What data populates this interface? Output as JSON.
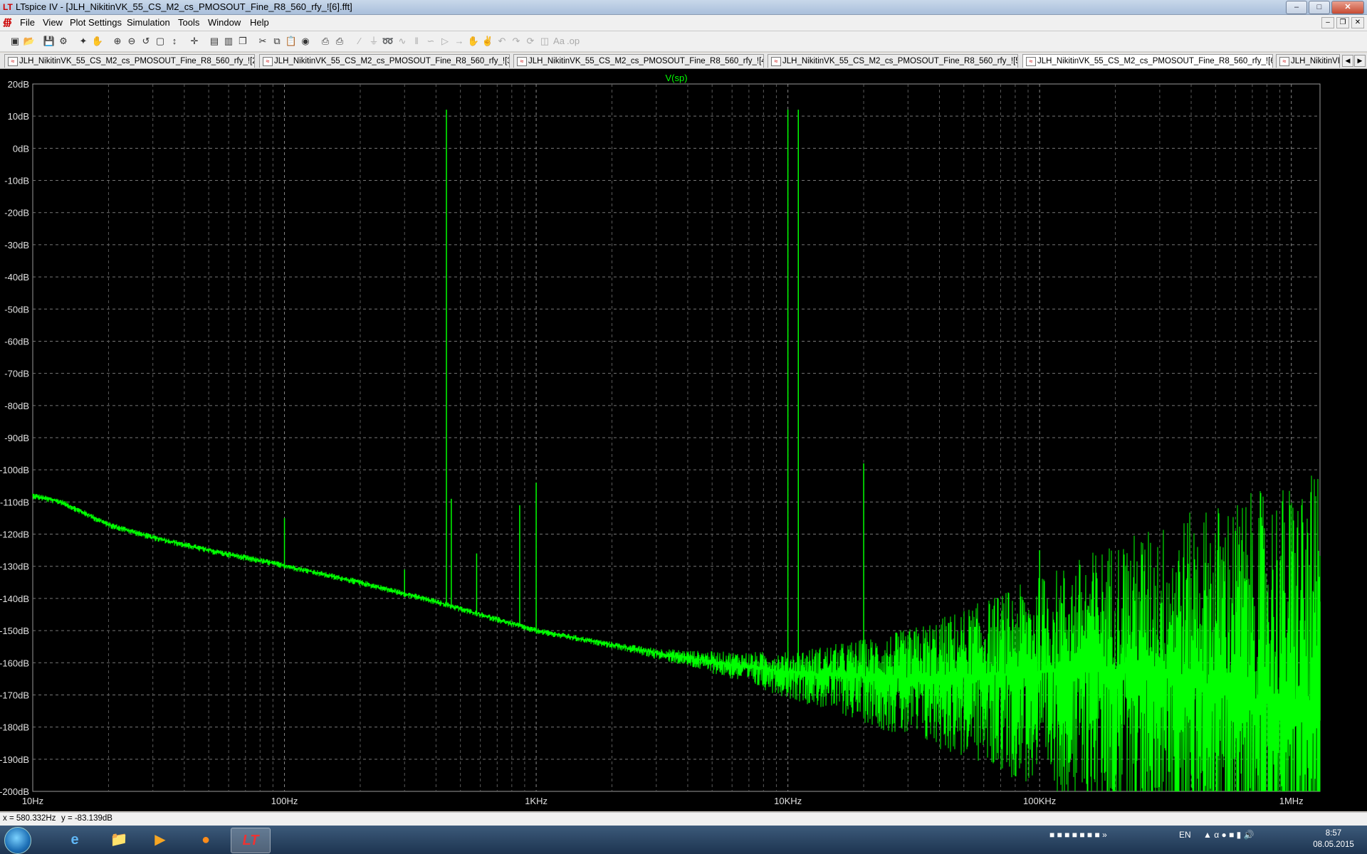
{
  "window": {
    "title": "LTspice IV - [JLH_NikitinVK_55_CS_M2_cs_PMOSOUT_Fine_R8_560_rfy_![6].fft]",
    "icon": "ltspice-icon"
  },
  "menubar": {
    "items": [
      "File",
      "View",
      "Plot Settings",
      "Simulation",
      "Tools",
      "Window",
      "Help"
    ]
  },
  "toolbar": {
    "icons": [
      "new-schematic-icon",
      "open-icon",
      "save-icon",
      "control-panel-icon",
      "run-icon",
      "halt-icon",
      "zoom-in-icon",
      "zoom-out-icon",
      "zoom-back-icon",
      "zoom-fit-icon",
      "autoscale-icon",
      "cursor-icon",
      "tile-horizontal-icon",
      "tile-vertical-icon",
      "cascade-icon",
      "cut-icon",
      "copy-icon",
      "paste-icon",
      "find-icon",
      "print-icon",
      "print-preview-icon",
      "wire-icon",
      "ground-icon",
      "label-icon",
      "resistor-icon",
      "capacitor-icon",
      "inductor-icon",
      "diode-icon",
      "component-icon",
      "move-icon",
      "drag-icon",
      "undo-icon",
      "redo-icon",
      "rotate-icon",
      "mirror-icon",
      "text-icon",
      "spice-directive-icon"
    ]
  },
  "tabs": [
    {
      "label": "JLH_NikitinVK_55_CS_M2_cs_PMOSOUT_Fine_R8_560_rfy_![2].fft",
      "active": false
    },
    {
      "label": "JLH_NikitinVK_55_CS_M2_cs_PMOSOUT_Fine_R8_560_rfy_![3].fft",
      "active": false
    },
    {
      "label": "JLH_NikitinVK_55_CS_M2_cs_PMOSOUT_Fine_R8_560_rfy_![4].fft",
      "active": false
    },
    {
      "label": "JLH_NikitinVK_55_CS_M2_cs_PMOSOUT_Fine_R8_560_rfy_![5].fft",
      "active": false
    },
    {
      "label": "JLH_NikitinVK_55_CS_M2_cs_PMOSOUT_Fine_R8_560_rfy_![6].fft",
      "active": true
    },
    {
      "label": "JLH_NikitinVK",
      "active": false
    }
  ],
  "chart_data": {
    "type": "line",
    "title": "V(sp)",
    "series": [
      {
        "name": "V(sp)",
        "color": "#00ff00"
      }
    ],
    "x_scale": "log",
    "xlim_hz": [
      10,
      1300000
    ],
    "x_ticks": [
      "10Hz",
      "100Hz",
      "1KHz",
      "10KHz",
      "100KHz",
      "1MHz"
    ],
    "ylim_db": [
      -200,
      20
    ],
    "y_ticks": [
      "20dB",
      "10dB",
      "0dB",
      "-10dB",
      "-20dB",
      "-30dB",
      "-40dB",
      "-50dB",
      "-60dB",
      "-70dB",
      "-80dB",
      "-90dB",
      "-100dB",
      "-110dB",
      "-120dB",
      "-130dB",
      "-140dB",
      "-150dB",
      "-160dB",
      "-170dB",
      "-180dB",
      "-190dB",
      "-200dB"
    ],
    "grid": true,
    "background": "#000000",
    "noise_floor": [
      [
        10,
        -108
      ],
      [
        13,
        -110
      ],
      [
        20,
        -117
      ],
      [
        30,
        -121
      ],
      [
        50,
        -125
      ],
      [
        90,
        -129
      ],
      [
        200,
        -135
      ],
      [
        400,
        -141
      ],
      [
        1000,
        -150
      ],
      [
        3000,
        -157
      ],
      [
        10000,
        -163
      ],
      [
        30000,
        -165
      ],
      [
        100000,
        -163
      ],
      [
        200000,
        -162
      ],
      [
        500000,
        -167
      ],
      [
        1300000,
        -178
      ]
    ],
    "peaks": [
      {
        "x": 100,
        "y": -115
      },
      {
        "x": 300,
        "y": -131
      },
      {
        "x": 440,
        "y": 12
      },
      {
        "x": 460,
        "y": -109
      },
      {
        "x": 580,
        "y": -126
      },
      {
        "x": 860,
        "y": -111
      },
      {
        "x": 1000,
        "y": -104
      },
      {
        "x": 10000,
        "y": 12
      },
      {
        "x": 11000,
        "y": 12
      },
      {
        "x": 20000,
        "y": -98
      },
      {
        "x": 100000,
        "y": -125
      },
      {
        "x": 600000,
        "y": -119
      },
      {
        "x": 1100000,
        "y": -111
      },
      {
        "x": 1300000,
        "y": -141
      }
    ]
  },
  "statusbar": {
    "x": "x = 580.332Hz",
    "y": "y = -83.139dB"
  },
  "taskbar": {
    "apps": [
      "start-orb-icon",
      "internet-explorer-icon",
      "file-explorer-icon",
      "media-player-icon",
      "firefox-icon",
      "ltspice-icon"
    ],
    "lang": "EN",
    "time": "8:57",
    "date": "08.05.2015"
  }
}
